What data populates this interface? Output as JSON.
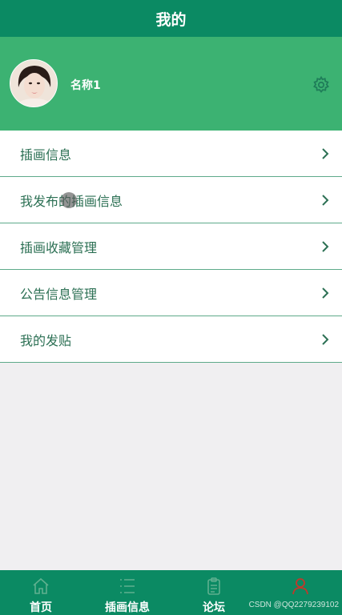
{
  "header": {
    "title": "我的"
  },
  "profile": {
    "username": "名称1",
    "avatar_icon": "user-avatar-photo",
    "settings_icon": "gear-icon"
  },
  "menu": {
    "items": [
      {
        "label": "插画信息",
        "icon": "chevron-right-icon"
      },
      {
        "label": "我发布的插画信息",
        "icon": "chevron-right-icon"
      },
      {
        "label": "插画收藏管理",
        "icon": "chevron-right-icon"
      },
      {
        "label": "公告信息管理",
        "icon": "chevron-right-icon"
      },
      {
        "label": "我的发贴",
        "icon": "chevron-right-icon"
      }
    ]
  },
  "tabbar": {
    "items": [
      {
        "label": "首页",
        "icon": "home-icon"
      },
      {
        "label": "插画信息",
        "icon": "list-icon"
      },
      {
        "label": "论坛",
        "icon": "clipboard-icon"
      },
      {
        "label": "",
        "icon": "user-icon"
      }
    ]
  },
  "watermark": "CSDN @QQ2279239102",
  "colors": {
    "header_bg": "#0b8a63",
    "profile_bg": "#3cb272",
    "menu_text": "#2c7054",
    "divider": "#5eaa8a",
    "page_bg": "#f0eff1",
    "mine_tab_icon": "#c0392b"
  }
}
